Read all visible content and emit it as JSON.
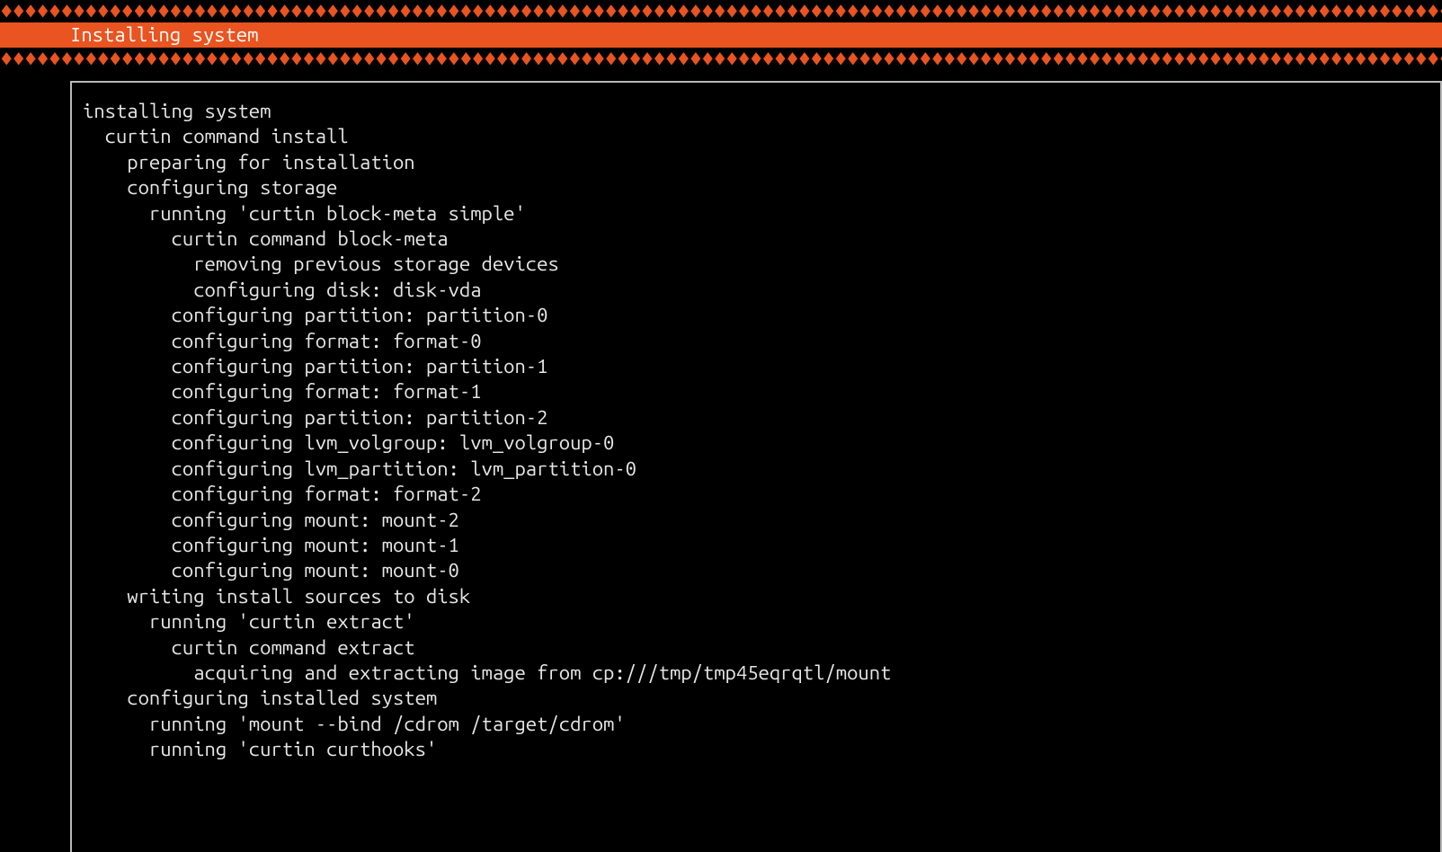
{
  "border_pattern": "♦♦♦♦♦♦♦♦♦♦♦♦♦♦♦♦♦♦♦♦♦♦♦♦♦♦♦♦♦♦♦♦♦♦♦♦♦♦♦♦♦♦♦♦♦♦♦♦♦♦♦♦♦♦♦♦♦♦♦♦♦♦♦♦♦♦♦♦♦♦♦♦♦♦♦♦♦♦♦♦♦♦♦♦♦♦♦♦♦♦♦♦♦♦♦♦♦♦♦♦♦♦♦♦♦♦♦♦♦♦♦♦♦♦♦♦♦♦♦♦♦♦♦♦♦♦♦♦♦♦♦♦♦♦♦♦♦♦♦♦♦♦♦♦♦♦♦♦♦♦",
  "title": "Installing system",
  "log_lines": [
    {
      "indent": 0,
      "text": "installing system"
    },
    {
      "indent": 1,
      "text": "curtin command install"
    },
    {
      "indent": 2,
      "text": "preparing for installation"
    },
    {
      "indent": 2,
      "text": "configuring storage"
    },
    {
      "indent": 3,
      "text": "running 'curtin block-meta simple'"
    },
    {
      "indent": 4,
      "text": "curtin command block-meta"
    },
    {
      "indent": 5,
      "text": "removing previous storage devices"
    },
    {
      "indent": 5,
      "text": "configuring disk: disk-vda"
    },
    {
      "indent": 4,
      "text": "configuring partition: partition-0"
    },
    {
      "indent": 4,
      "text": "configuring format: format-0"
    },
    {
      "indent": 4,
      "text": "configuring partition: partition-1"
    },
    {
      "indent": 4,
      "text": "configuring format: format-1"
    },
    {
      "indent": 4,
      "text": "configuring partition: partition-2"
    },
    {
      "indent": 4,
      "text": "configuring lvm_volgroup: lvm_volgroup-0"
    },
    {
      "indent": 4,
      "text": "configuring lvm_partition: lvm_partition-0"
    },
    {
      "indent": 4,
      "text": "configuring format: format-2"
    },
    {
      "indent": 4,
      "text": "configuring mount: mount-2"
    },
    {
      "indent": 4,
      "text": "configuring mount: mount-1"
    },
    {
      "indent": 4,
      "text": "configuring mount: mount-0"
    },
    {
      "indent": 2,
      "text": "writing install sources to disk"
    },
    {
      "indent": 3,
      "text": "running 'curtin extract'"
    },
    {
      "indent": 4,
      "text": "curtin command extract"
    },
    {
      "indent": 5,
      "text": "acquiring and extracting image from cp:///tmp/tmp45eqrqtl/mount"
    },
    {
      "indent": 2,
      "text": "configuring installed system"
    },
    {
      "indent": 3,
      "text": "running 'mount --bind /cdrom /target/cdrom'"
    },
    {
      "indent": 3,
      "text": "running 'curtin curthooks'"
    }
  ]
}
